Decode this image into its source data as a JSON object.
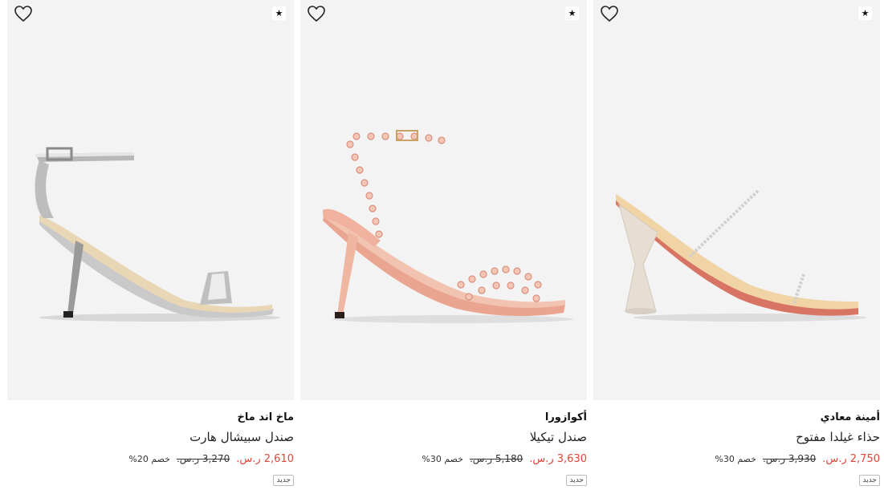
{
  "products": [
    {
      "brand": "ماخ اند ماخ",
      "name": "صندل سبيشال هارت",
      "price": "2,610 ر.س.",
      "old_price": "3,270 ر.س.",
      "discount": "خصم 20%",
      "tag": "جديد",
      "heart_icon": "heart-outline-icon",
      "badge_icon": "star-icon",
      "badge_symbol": "★"
    },
    {
      "brand": "أكوازورا",
      "name": "صندل تيكيلا",
      "price": "3,630 ر.س.",
      "old_price": "5,180 ر.س.",
      "discount": "خصم 30%",
      "tag": "جديد",
      "heart_icon": "heart-outline-icon",
      "badge_icon": "star-icon",
      "badge_symbol": "★"
    },
    {
      "brand": "أمينة معادي",
      "name": "حذاء غيلدا مفتوح",
      "price": "2,750 ر.س.",
      "old_price": "3,930 ر.س.",
      "discount": "خصم 30%",
      "tag": "جديد",
      "heart_icon": "heart-outline-icon",
      "badge_icon": "star-icon",
      "badge_symbol": "★"
    }
  ],
  "colors": {
    "image_bg": "#f3f3f3",
    "sale_price": "#e0463b",
    "text": "#222222"
  }
}
